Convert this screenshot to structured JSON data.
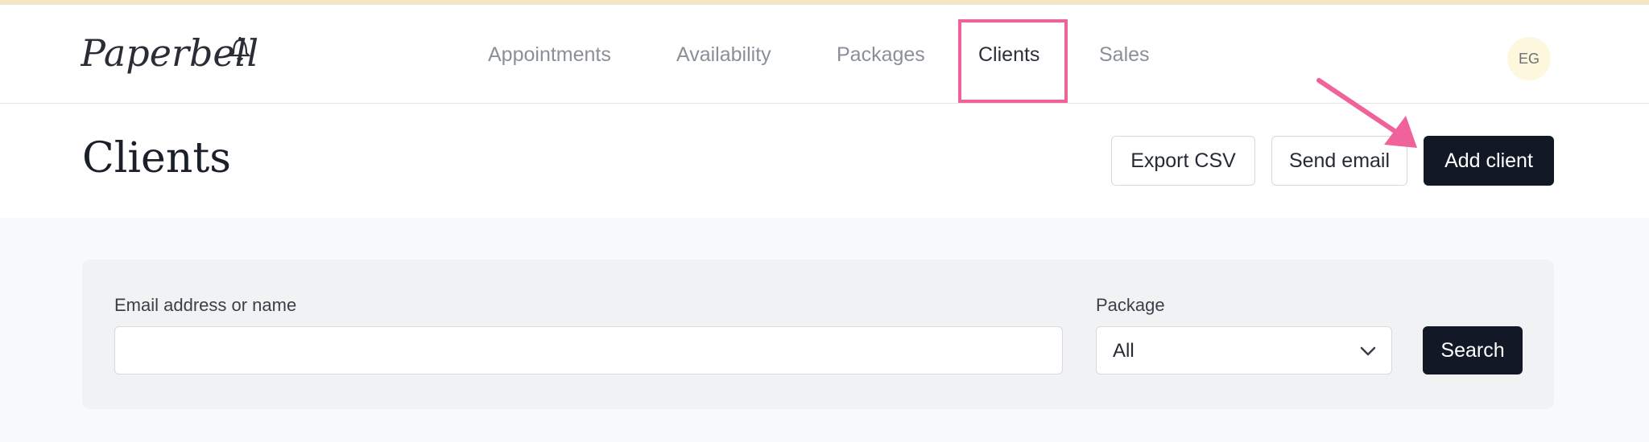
{
  "brand": {
    "logo_text": "Paperbell"
  },
  "nav": {
    "items": [
      {
        "label": "Appointments"
      },
      {
        "label": "Availability"
      },
      {
        "label": "Packages"
      },
      {
        "label": "Clients"
      },
      {
        "label": "Sales"
      }
    ],
    "active": "Clients"
  },
  "user": {
    "initials": "EG"
  },
  "header": {
    "title": "Clients",
    "buttons": {
      "export_csv": "Export CSV",
      "send_email": "Send email",
      "add_client": "Add client"
    }
  },
  "search": {
    "email_label": "Email address or name",
    "email_value": "",
    "package_label": "Package",
    "package_selected": "All",
    "search_button": "Search"
  },
  "annotations": {
    "highlight_color": "#f0639a",
    "arrow_color": "#f0639a"
  },
  "icons": [
    "bell-icon",
    "chevron-down-icon"
  ]
}
